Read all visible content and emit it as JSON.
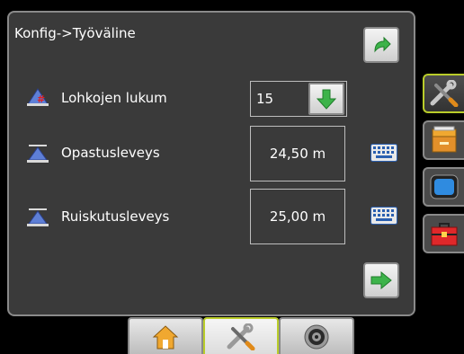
{
  "header": {
    "title": "Konfig->Työväline"
  },
  "rows": [
    {
      "label": "Lohkojen lukum",
      "value": "15",
      "icon": "boom-sections-icon"
    },
    {
      "label": "Opastusleveys",
      "value": "24,50 m",
      "icon": "guidance-width-icon"
    },
    {
      "label": "Ruiskutusleveys",
      "value": "25,00 m",
      "icon": "application-width-icon"
    }
  ],
  "buttons": {
    "back": "back-arrow-icon",
    "dropdown": "down-arrow-icon",
    "next": "next-arrow-icon",
    "keyboard": "keyboard-icon"
  },
  "side_tabs": [
    "tools-icon",
    "data-management-icon",
    "display-icon",
    "toolbox-icon"
  ],
  "bottom_tabs": [
    "home-icon",
    "configuration-icon",
    "guidance-icon"
  ],
  "colors": {
    "accent": "#b9cc2a",
    "arrow_green": "#3db34a",
    "panel": "#3a3a3a"
  }
}
